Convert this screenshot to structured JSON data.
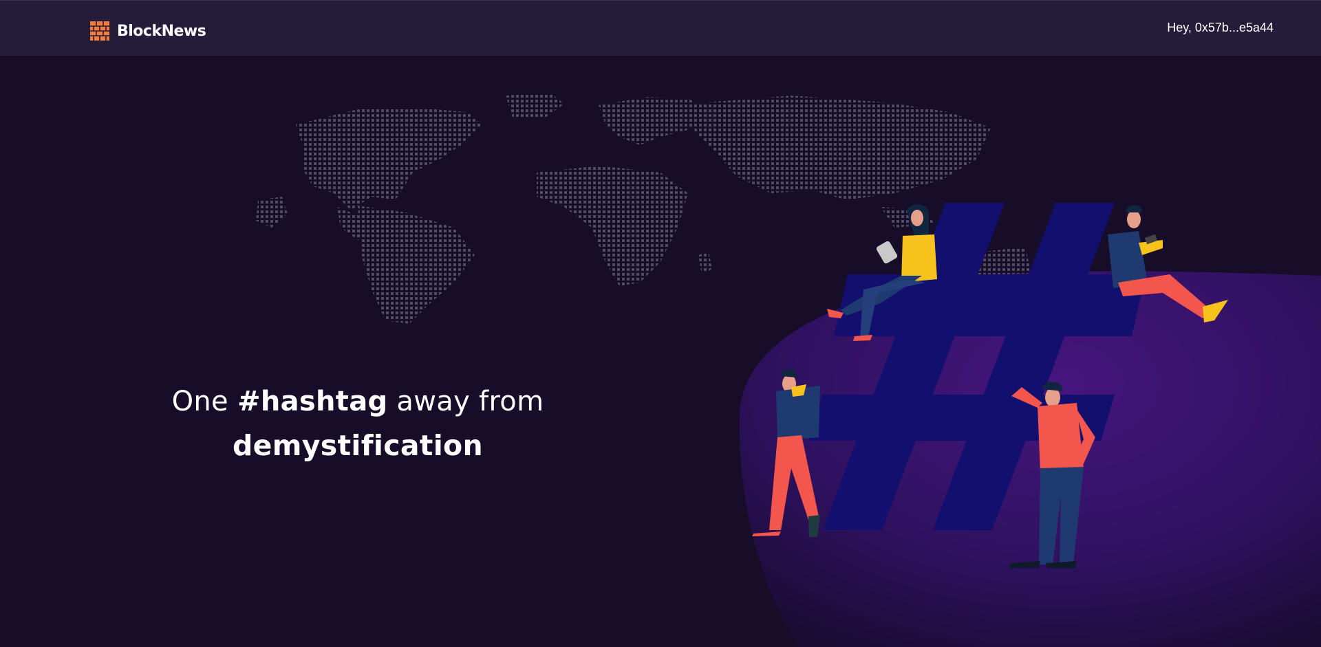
{
  "navbar": {
    "brand_name": "BlockNews",
    "account_label": "Hey, 0x57b...e5a44"
  },
  "hero": {
    "headline_line1_pre": "One ",
    "headline_hashtag": "#hashtag",
    "headline_line1_post": " away from",
    "headline_line2": "demystification"
  },
  "colors": {
    "background": "#170d29",
    "navbar": "#251c3a",
    "brand_accent": "#f47c3c",
    "hashtag": "#120f6e",
    "blob": "#3c1470",
    "map_dots": "#55506a"
  }
}
